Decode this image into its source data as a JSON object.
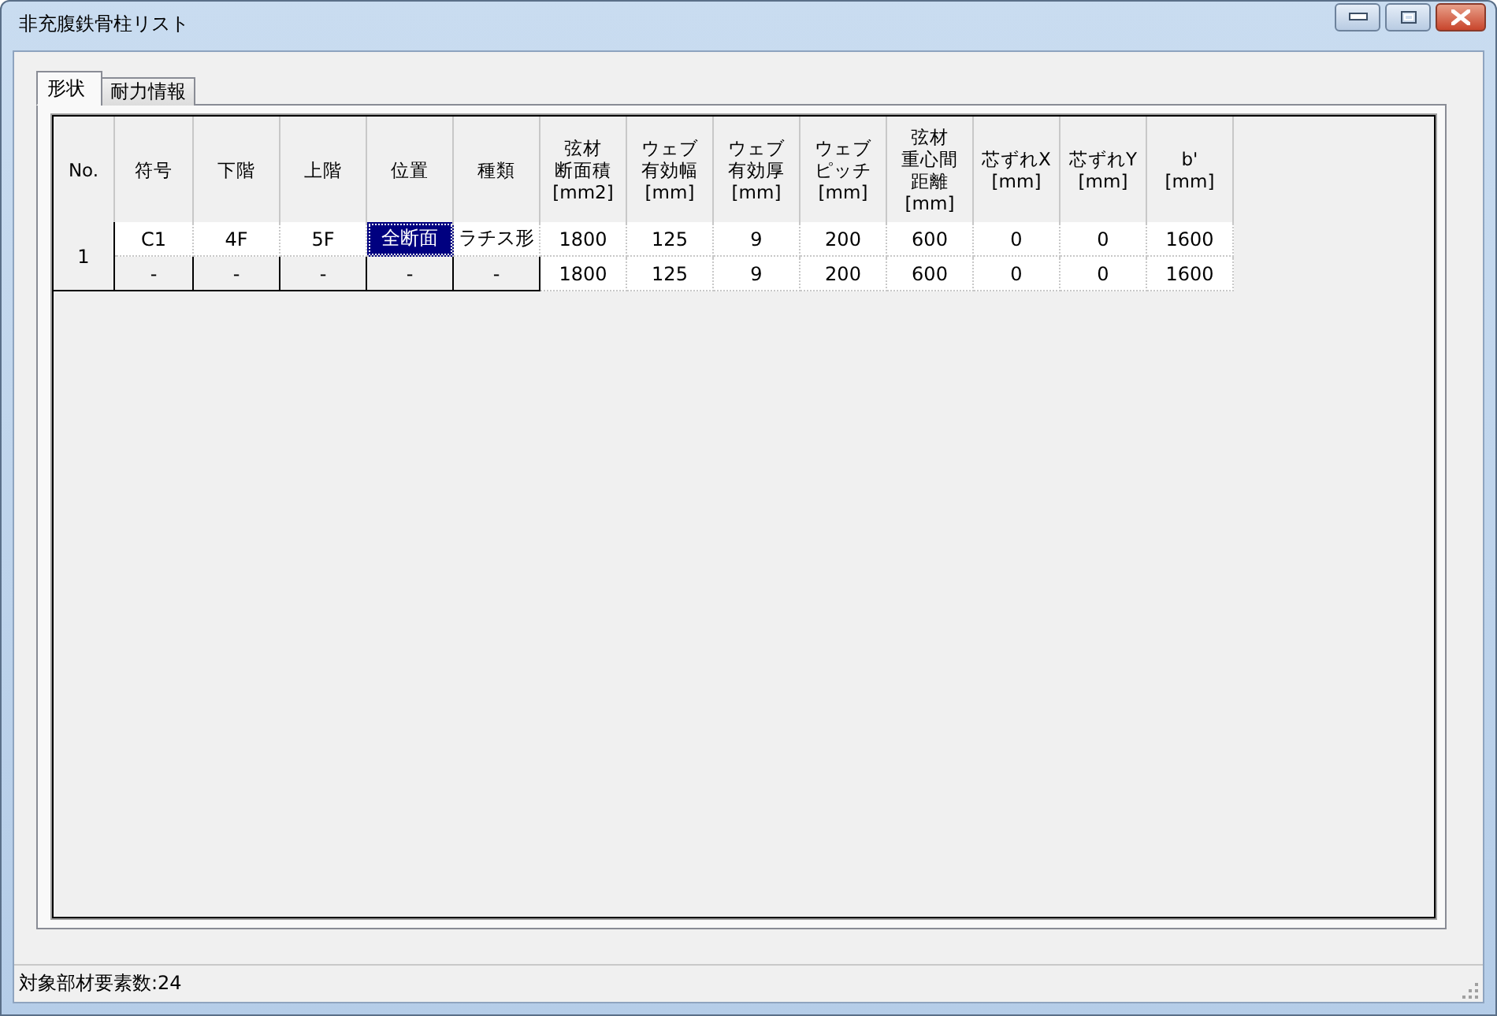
{
  "window": {
    "title": "非充腹鉄骨柱リスト"
  },
  "tabs": [
    {
      "label": "形状",
      "selected": true
    },
    {
      "label": "耐力情報",
      "selected": false
    }
  ],
  "table": {
    "columns": [
      {
        "lines": [
          "No."
        ]
      },
      {
        "lines": [
          "符号"
        ]
      },
      {
        "lines": [
          "下階"
        ]
      },
      {
        "lines": [
          "上階"
        ]
      },
      {
        "lines": [
          "位置"
        ]
      },
      {
        "lines": [
          "種類"
        ]
      },
      {
        "lines": [
          "弦材",
          "断面積",
          "[mm2]"
        ]
      },
      {
        "lines": [
          "ウェブ",
          "有効幅",
          "[mm]"
        ]
      },
      {
        "lines": [
          "ウェブ",
          "有効厚",
          "[mm]"
        ]
      },
      {
        "lines": [
          "ウェブ",
          "ピッチ",
          "[mm]"
        ]
      },
      {
        "lines": [
          "弦材",
          "重心間",
          "距離",
          "[mm]"
        ]
      },
      {
        "lines": [
          "芯ずれX",
          "[mm]"
        ]
      },
      {
        "lines": [
          "芯ずれY",
          "[mm]"
        ]
      },
      {
        "lines": [
          "b'",
          "[mm]"
        ]
      }
    ],
    "groups": [
      {
        "no": "1",
        "rows": [
          {
            "cells": [
              {
                "text": "C1",
                "selected": false,
                "disabled": false
              },
              {
                "text": "4F",
                "selected": false,
                "disabled": false
              },
              {
                "text": "5F",
                "selected": false,
                "disabled": false
              },
              {
                "text": "全断面",
                "selected": true,
                "disabled": false
              },
              {
                "text": "ラチス形",
                "selected": false,
                "disabled": false
              },
              {
                "text": "1800",
                "selected": false,
                "disabled": false
              },
              {
                "text": "125",
                "selected": false,
                "disabled": false
              },
              {
                "text": "9",
                "selected": false,
                "disabled": false
              },
              {
                "text": "200",
                "selected": false,
                "disabled": false
              },
              {
                "text": "600",
                "selected": false,
                "disabled": false
              },
              {
                "text": "0",
                "selected": false,
                "disabled": false
              },
              {
                "text": "0",
                "selected": false,
                "disabled": false
              },
              {
                "text": "1600",
                "selected": false,
                "disabled": false
              }
            ]
          },
          {
            "cells": [
              {
                "text": "-",
                "selected": false,
                "disabled": true
              },
              {
                "text": "-",
                "selected": false,
                "disabled": true
              },
              {
                "text": "-",
                "selected": false,
                "disabled": true
              },
              {
                "text": "-",
                "selected": false,
                "disabled": true
              },
              {
                "text": "-",
                "selected": false,
                "disabled": true
              },
              {
                "text": "1800",
                "selected": false,
                "disabled": false
              },
              {
                "text": "125",
                "selected": false,
                "disabled": false
              },
              {
                "text": "9",
                "selected": false,
                "disabled": false
              },
              {
                "text": "200",
                "selected": false,
                "disabled": false
              },
              {
                "text": "600",
                "selected": false,
                "disabled": false
              },
              {
                "text": "0",
                "selected": false,
                "disabled": false
              },
              {
                "text": "0",
                "selected": false,
                "disabled": false
              },
              {
                "text": "1600",
                "selected": false,
                "disabled": false
              }
            ]
          }
        ]
      }
    ]
  },
  "status_bar": {
    "text": "対象部材要素数:24"
  }
}
